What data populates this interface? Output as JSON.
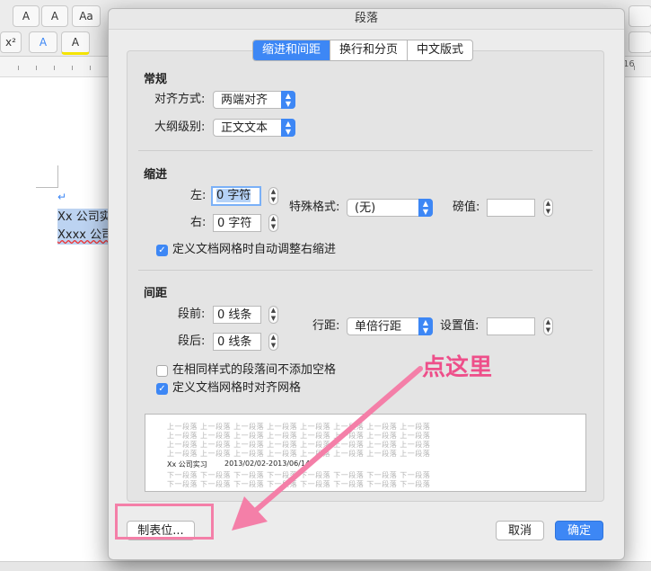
{
  "background_app": {
    "toolbar": {
      "font_grow": "A",
      "font_shrink": "A",
      "clear_format": "Aa",
      "superscript": "x²",
      "text_effect": "A",
      "highlight": "A"
    },
    "ruler": {
      "marker_16": "16"
    },
    "document_lines": [
      "Xx 公司实",
      "Xxxx 公司"
    ]
  },
  "dialog": {
    "title": "段落",
    "tabs": [
      {
        "label": "缩进和间距",
        "active": true
      },
      {
        "label": "换行和分页",
        "active": false
      },
      {
        "label": "中文版式",
        "active": false
      }
    ],
    "general": {
      "section_title": "常规",
      "alignment_label": "对齐方式:",
      "alignment_value": "两端对齐",
      "outline_label": "大纲级别:",
      "outline_value": "正文文本"
    },
    "indent": {
      "section_title": "缩进",
      "left_label": "左:",
      "left_value": "0 字符",
      "right_label": "右:",
      "right_value": "0 字符",
      "special_label": "特殊格式:",
      "special_value": "(无)",
      "by_label": "磅值:",
      "by_value": "",
      "auto_adjust_label": "定义文档网格时自动调整右缩进",
      "auto_adjust_checked": true
    },
    "spacing": {
      "section_title": "间距",
      "before_label": "段前:",
      "before_value": "0 线条",
      "after_label": "段后:",
      "after_value": "0 线条",
      "line_spacing_label": "行距:",
      "line_spacing_value": "单倍行距",
      "at_label": "设置值:",
      "at_value": "",
      "no_space_same_style_label": "在相同样式的段落间不添加空格",
      "no_space_same_style_checked": false,
      "snap_to_grid_label": "定义文档网格时对齐网格",
      "snap_to_grid_checked": true
    },
    "preview": {
      "prev_text": "上一段落 上一段落 上一段落 上一段落 上一段落 上一段落 上一段落 上一段落",
      "current_title": "Xx 公司实习",
      "current_dates": "2013/02/02-2013/06/14",
      "next_text": "下一段落 下一段落 下一段落 下一段落 下一段落 下一段落 下一段落 下一段落"
    },
    "buttons": {
      "tabs": "制表位...",
      "cancel": "取消",
      "ok": "确定"
    }
  },
  "annotation": {
    "text": "点这里",
    "color": "#ee4f8a"
  }
}
